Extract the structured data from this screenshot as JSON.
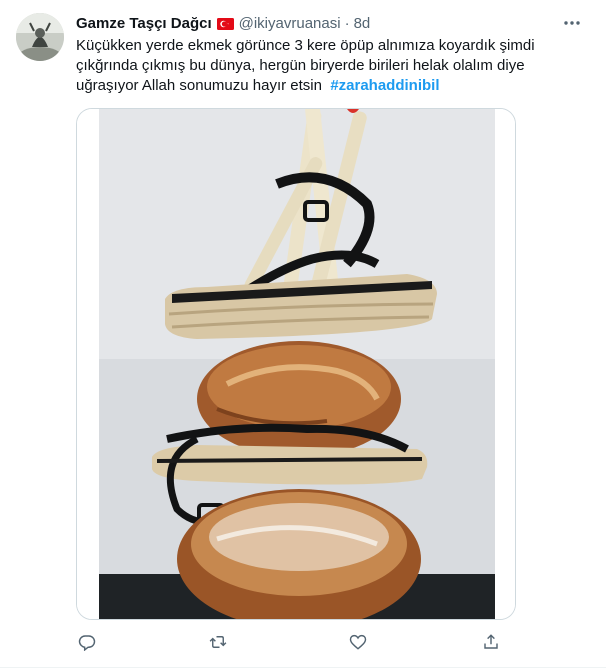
{
  "author": {
    "display_name": "Gamze Taşçı Dağcı",
    "flag_icon": "turkey-flag-icon",
    "handle": "@ikiyavruanasi",
    "separator": "·",
    "time": "8d"
  },
  "tweet": {
    "line1": "Küçükken yerde ekmek görünce 3 kere öpüp alnımıza koyardık şimdi",
    "line2": "çıkğrında çıkmış bu dünya, hergün biryerde birileri helak olalım diye",
    "line3": "uğraşıyor Allah sonumuzu hayır etsin",
    "hashtag": "#zarahaddinibil"
  },
  "media": {
    "description_icon": "photo-bread-sandals"
  },
  "actions": [
    {
      "name": "reply",
      "icon": "reply-icon"
    },
    {
      "name": "retweet",
      "icon": "retweet-icon"
    },
    {
      "name": "like",
      "icon": "like-icon"
    },
    {
      "name": "share",
      "icon": "share-icon"
    }
  ],
  "colors": {
    "accent": "#1d9bf0",
    "secondary_text": "#536471",
    "border": "#cfd9de"
  }
}
